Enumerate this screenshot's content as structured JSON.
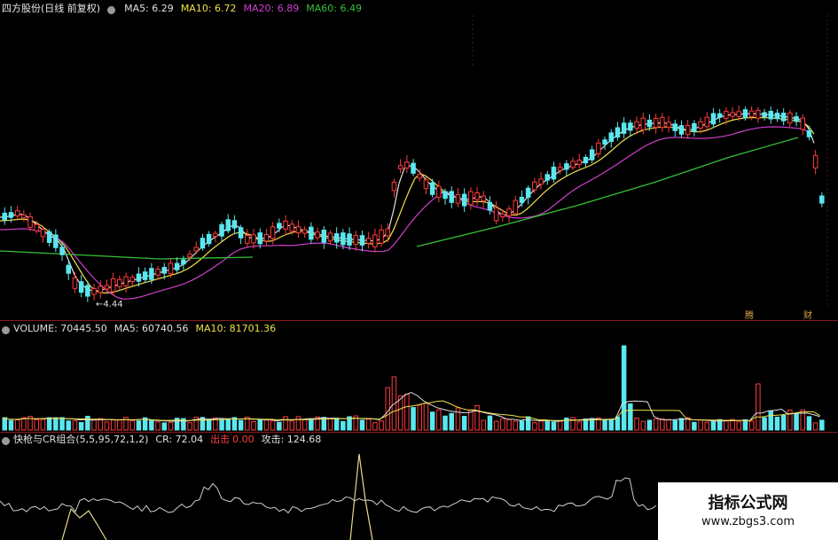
{
  "price_panel": {
    "stock_name": "四方股份",
    "period": "(日线 前复权)",
    "ma": [
      {
        "label": "MA5: 6.29",
        "color": "#e0e0e0"
      },
      {
        "label": "MA10: 6.72",
        "color": "#f0e04a"
      },
      {
        "label": "MA20: 6.89",
        "color": "#d040d0"
      },
      {
        "label": "MA60: 6.49",
        "color": "#36c036"
      }
    ],
    "low_marker": "4.44"
  },
  "volume_panel": {
    "title": "VOLUME: 70445.50",
    "ma5": "MA5: 60740.56",
    "ma10": "MA10: 81701.36"
  },
  "indicator_panel": {
    "title": "快枪与CR组合(5,5,95,72,1,2)",
    "cr": "CR: 72.04",
    "out_label": "出击",
    "out_value": "0.00",
    "attack": "攻击: 124.68"
  },
  "event_tags": [
    "腾",
    "财"
  ],
  "watermark": {
    "title": "指标公式网",
    "url": "www.zbgs3.com"
  },
  "colors": {
    "up": "#ff3b3b",
    "down": "#5ae8f0",
    "ma5": "#e0e0e0",
    "ma10": "#f0e04a",
    "ma20": "#d040d0",
    "ma60": "#36c036"
  }
}
